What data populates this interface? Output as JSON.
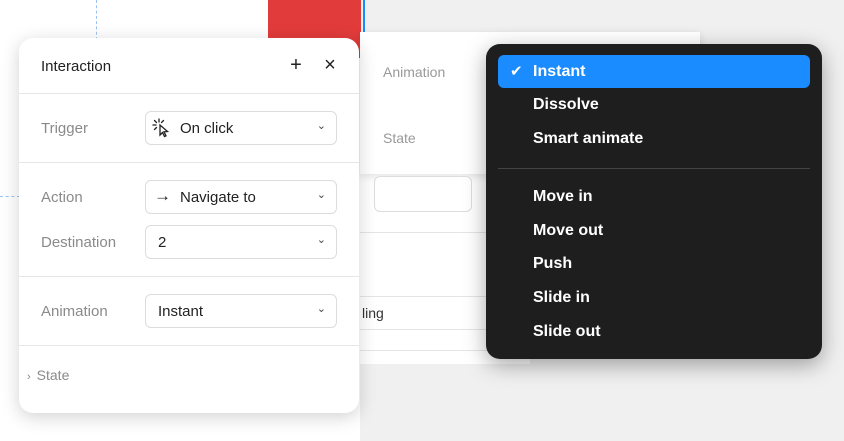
{
  "interaction_panel": {
    "title": "Interaction",
    "add_icon": "plus-icon",
    "close_icon": "close-icon",
    "trigger": {
      "label": "Trigger",
      "value": "On click",
      "icon": "tap-cursor-icon"
    },
    "action": {
      "label": "Action",
      "value": "Navigate to",
      "icon": "arrow-right-icon"
    },
    "destination": {
      "label": "Destination",
      "value": "2"
    },
    "animation": {
      "label": "Animation",
      "value": "Instant"
    },
    "state": {
      "label": "State"
    }
  },
  "background_panel": {
    "animation_label": "Animation",
    "state_label": "State",
    "partial_field_text": "ling"
  },
  "animation_menu": {
    "selected": "Instant",
    "group1": [
      "Instant",
      "Dissolve",
      "Smart animate"
    ],
    "group2": [
      "Move in",
      "Move out",
      "Push",
      "Slide in",
      "Slide out"
    ]
  },
  "colors": {
    "menu_background": "#1e1e1e",
    "menu_selected": "#1a8cff",
    "canvas_frame_red": "#e23b3b",
    "panel_background": "#ffffff"
  }
}
